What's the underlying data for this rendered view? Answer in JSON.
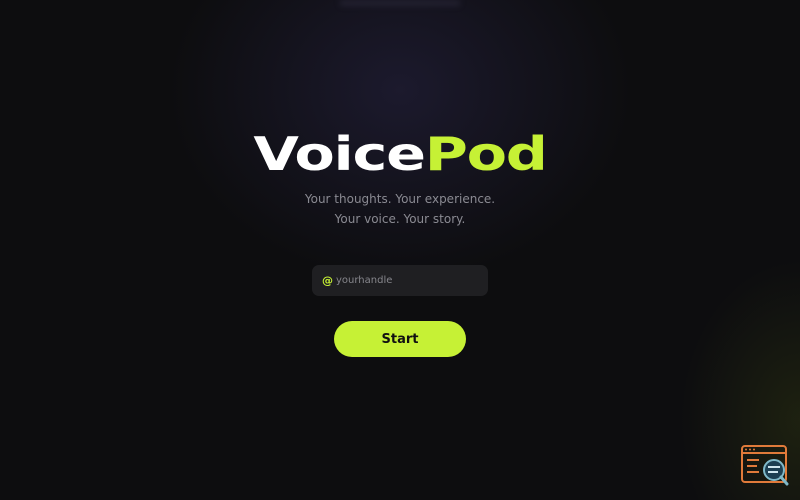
{
  "brand": {
    "name_part1": "Voice",
    "name_part2": "Pod",
    "accent_color": "#c6f135"
  },
  "tagline": {
    "line1": "Your thoughts. Your experience.",
    "line2": "Your voice. Your story."
  },
  "handle_input": {
    "prefix": "@",
    "placeholder": "yourhandle",
    "value": ""
  },
  "start_button": {
    "label": "Start"
  },
  "corner_widget": {
    "icon": "browser-search-icon"
  }
}
